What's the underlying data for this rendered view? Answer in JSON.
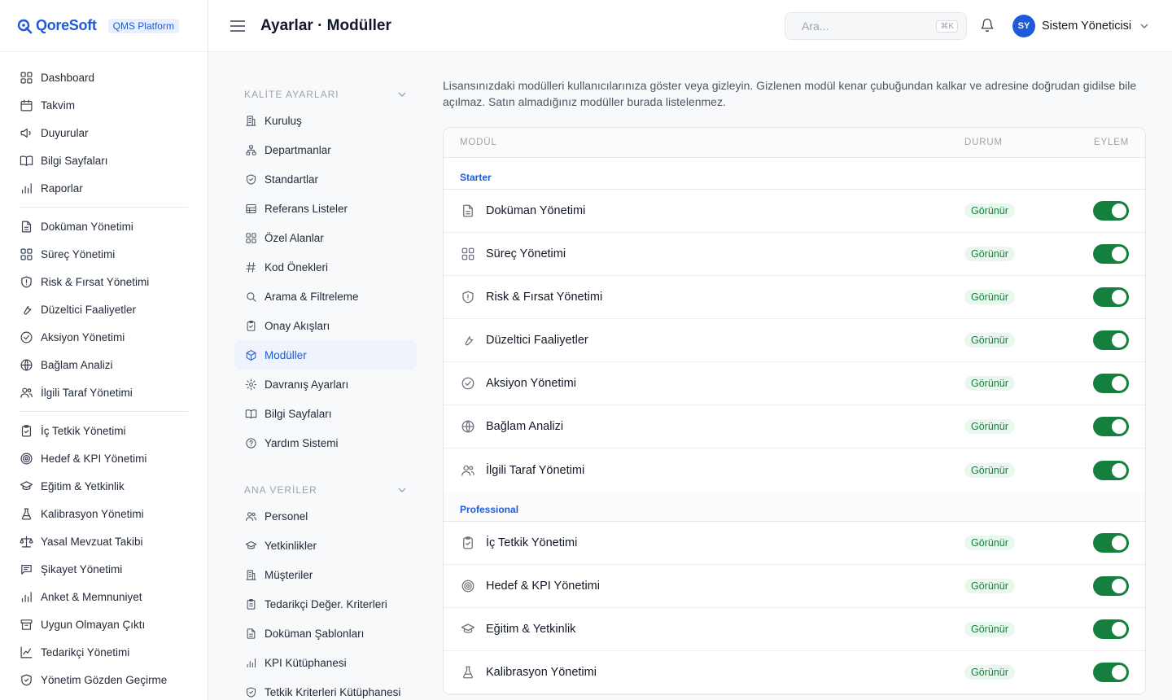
{
  "brand": {
    "name": "QoreSoft",
    "badge": "QMS Platform"
  },
  "colors": {
    "accent": "#1d5bd8",
    "toggle_on": "#15803d",
    "badge_bg": "#e9f7ee",
    "badge_text": "#15803d"
  },
  "sidebar": {
    "groups": [
      [
        {
          "label": "Dashboard",
          "icon": "grid-icon"
        },
        {
          "label": "Takvim",
          "icon": "calendar-icon"
        },
        {
          "label": "Duyurular",
          "icon": "megaphone-icon"
        },
        {
          "label": "Bilgi Sayfaları",
          "icon": "book-icon"
        },
        {
          "label": "Raporlar",
          "icon": "bar-chart-icon"
        }
      ],
      [
        {
          "label": "Doküman Yönetimi",
          "icon": "document-icon"
        },
        {
          "label": "Süreç Yönetimi",
          "icon": "grid-icon"
        },
        {
          "label": "Risk & Fırsat Yönetimi",
          "icon": "shield-alert-icon"
        },
        {
          "label": "Düzeltici Faaliyetler",
          "icon": "wrench-icon"
        },
        {
          "label": "Aksiyon Yönetimi",
          "icon": "check-circle-icon"
        },
        {
          "label": "Bağlam Analizi",
          "icon": "globe-icon"
        },
        {
          "label": "İlgili Taraf Yönetimi",
          "icon": "users-icon"
        }
      ],
      [
        {
          "label": "İç Tetkik Yönetimi",
          "icon": "clipboard-check-icon"
        },
        {
          "label": "Hedef & KPI Yönetimi",
          "icon": "target-icon"
        },
        {
          "label": "Eğitim & Yetkinlik",
          "icon": "graduation-cap-icon"
        },
        {
          "label": "Kalibrasyon Yönetimi",
          "icon": "flask-icon"
        },
        {
          "label": "Yasal Mevzuat Takibi",
          "icon": "scale-icon"
        },
        {
          "label": "Şikayet Yönetimi",
          "icon": "message-icon"
        },
        {
          "label": "Anket & Memnuniyet",
          "icon": "bar-chart-icon"
        },
        {
          "label": "Uygun Olmayan Çıktı",
          "icon": "archive-icon"
        },
        {
          "label": "Tedarikçi Yönetimi",
          "icon": "line-chart-icon"
        },
        {
          "label": "Yönetim Gözden Geçirme",
          "icon": "shield-check-icon"
        }
      ]
    ]
  },
  "header": {
    "title": "Ayarlar · Modüller",
    "search_placeholder": "Ara...",
    "search_shortcut": "⌘K",
    "user_initials": "SY",
    "user_name": "Sistem Yöneticisi"
  },
  "settings_nav": {
    "section_quality": "KALİTE AYARLARI",
    "quality_items": [
      {
        "label": "Kuruluş",
        "icon": "building-icon"
      },
      {
        "label": "Departmanlar",
        "icon": "org-chart-icon"
      },
      {
        "label": "Standartlar",
        "icon": "shield-check-icon"
      },
      {
        "label": "Referans Listeler",
        "icon": "table-icon"
      },
      {
        "label": "Özel Alanlar",
        "icon": "grid-icon"
      },
      {
        "label": "Kod Önekleri",
        "icon": "hash-icon"
      },
      {
        "label": "Arama & Filtreleme",
        "icon": "search-icon"
      },
      {
        "label": "Onay Akışları",
        "icon": "clipboard-check-icon"
      },
      {
        "label": "Modüller",
        "icon": "package-icon",
        "active": true
      },
      {
        "label": "Davranış Ayarları",
        "icon": "gear-icon"
      },
      {
        "label": "Bilgi Sayfaları",
        "icon": "book-icon"
      },
      {
        "label": "Yardım Sistemi",
        "icon": "help-circle-icon"
      }
    ],
    "section_master": "ANA VERİLER",
    "master_items": [
      {
        "label": "Personel",
        "icon": "users-icon"
      },
      {
        "label": "Yetkinlikler",
        "icon": "graduation-cap-icon"
      },
      {
        "label": "Müşteriler",
        "icon": "building-icon"
      },
      {
        "label": "Tedarikçi Değer. Kriterleri",
        "icon": "clipboard-list-icon"
      },
      {
        "label": "Doküman Şablonları",
        "icon": "document-icon"
      },
      {
        "label": "KPI Kütüphanesi",
        "icon": "bar-chart-icon"
      },
      {
        "label": "Tetkik Kriterleri Kütüphanesi",
        "icon": "shield-check-icon"
      }
    ]
  },
  "main": {
    "description": "Lisansınızdaki modülleri kullanıcılarınıza göster veya gizleyin. Gizlenen modül kenar çubuğundan kalkar ve adresine doğrudan gidilse bile açılmaz. Satın almadığınız modüller burada listelenmez.",
    "columns": {
      "module": "MODÜL",
      "status": "DURUM",
      "action": "EYLEM"
    },
    "groups": [
      {
        "name": "Starter",
        "modules": [
          {
            "name": "Doküman Yönetimi",
            "icon": "document-icon",
            "status": "Görünür",
            "enabled": true
          },
          {
            "name": "Süreç Yönetimi",
            "icon": "grid-icon",
            "status": "Görünür",
            "enabled": true
          },
          {
            "name": "Risk & Fırsat Yönetimi",
            "icon": "shield-alert-icon",
            "status": "Görünür",
            "enabled": true
          },
          {
            "name": "Düzeltici Faaliyetler",
            "icon": "wrench-icon",
            "status": "Görünür",
            "enabled": true
          },
          {
            "name": "Aksiyon Yönetimi",
            "icon": "check-circle-icon",
            "status": "Görünür",
            "enabled": true
          },
          {
            "name": "Bağlam Analizi",
            "icon": "globe-icon",
            "status": "Görünür",
            "enabled": true
          },
          {
            "name": "İlgili Taraf Yönetimi",
            "icon": "users-icon",
            "status": "Görünür",
            "enabled": true
          }
        ]
      },
      {
        "name": "Professional",
        "modules": [
          {
            "name": "İç Tetkik Yönetimi",
            "icon": "clipboard-check-icon",
            "status": "Görünür",
            "enabled": true
          },
          {
            "name": "Hedef & KPI Yönetimi",
            "icon": "target-icon",
            "status": "Görünür",
            "enabled": true
          },
          {
            "name": "Eğitim & Yetkinlik",
            "icon": "graduation-cap-icon",
            "status": "Görünür",
            "enabled": true
          },
          {
            "name": "Kalibrasyon Yönetimi",
            "icon": "flask-icon",
            "status": "Görünür",
            "enabled": true
          }
        ]
      }
    ]
  }
}
